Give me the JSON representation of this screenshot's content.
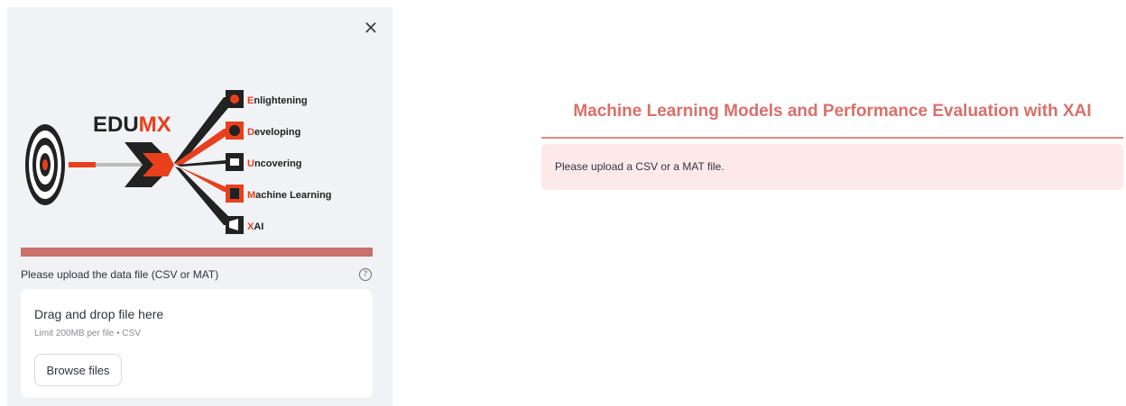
{
  "sidebar": {
    "close_symbol": "×",
    "logo": {
      "brand_main": "EDU",
      "brand_accent": "MX",
      "items": [
        {
          "initial": "E",
          "rest": "nlightening",
          "icon": "sun-icon"
        },
        {
          "initial": "D",
          "rest": "eveloping",
          "icon": "head-icon"
        },
        {
          "initial": "U",
          "rest": "ncovering",
          "icon": "camera-icon"
        },
        {
          "initial": "M",
          "rest": "achine Learning",
          "icon": "calculator-icon"
        },
        {
          "initial": "X",
          "rest": "AI",
          "icon": "megaphone-icon"
        }
      ]
    },
    "uploader": {
      "label": "Please upload the data file (CSV or MAT)",
      "help_symbol": "?",
      "drag_text": "Drag and drop file here",
      "limit_text": "Limit 200MB per file • CSV",
      "browse_label": "Browse files"
    }
  },
  "main": {
    "title": "Machine Learning Models and Performance Evaluation with XAI",
    "alert_text": "Please upload a CSV or a MAT file."
  },
  "colors": {
    "accent": "#d9706b",
    "logo_red": "#e8401c",
    "sidebar_bg": "#f0f2f6",
    "alert_bg": "#fde9ea"
  }
}
